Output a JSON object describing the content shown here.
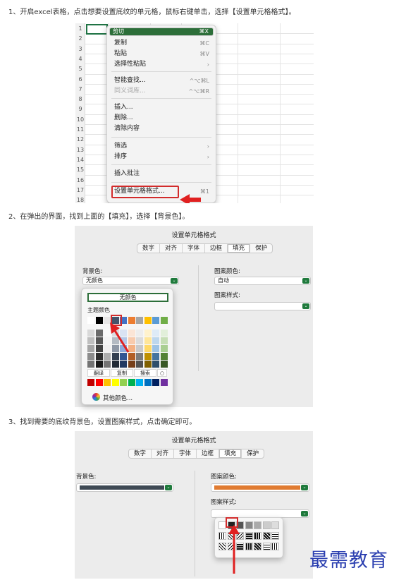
{
  "steps": {
    "s1": "1、开启excel表格，点击想要设置底纹的单元格，鼠标右键单击，选择【设置单元格格式】。",
    "s2": "2、在弹出的界面，找到上面的【填充】，选择【背景色】。",
    "s3": "3、找到需要的底纹背景色，设置图案样式，点击确定即可。"
  },
  "excel": {
    "rows": [
      "1",
      "2",
      "3",
      "4",
      "5",
      "6",
      "7",
      "8",
      "9",
      "10",
      "11",
      "12",
      "13",
      "14",
      "15",
      "16",
      "17",
      "18"
    ],
    "menu": [
      {
        "label": "剪切",
        "shortcut": "⌘X",
        "state": "selected"
      },
      {
        "label": "复制",
        "shortcut": "⌘C"
      },
      {
        "label": "粘贴",
        "shortcut": "⌘V"
      },
      {
        "label": "选择性粘贴",
        "shortcut": "›"
      },
      {
        "label": "智能查找...",
        "shortcut": "^⌥⌘L"
      },
      {
        "label": "同义词库...",
        "shortcut": "^⌥⌘R",
        "state": "disabled"
      },
      {
        "label": "插入..."
      },
      {
        "label": "删除..."
      },
      {
        "label": "清除内容"
      },
      {
        "label": "筛选",
        "shortcut": "›"
      },
      {
        "label": "排序",
        "shortcut": "›"
      },
      {
        "label": "插入批注"
      },
      {
        "label": "设置单元格格式...",
        "shortcut": "⌘1"
      }
    ]
  },
  "dialog": {
    "title": "设置单元格格式",
    "tabs": [
      "数字",
      "对齐",
      "字体",
      "边框",
      "填充",
      "保护"
    ],
    "active_tab": "填充",
    "bg_label": "背景色:",
    "bg_value": "无颜色",
    "pattern_color_label": "图案颜色:",
    "pattern_color_value": "自动",
    "pattern_style_label": "图案样式:"
  },
  "palette": {
    "no_color": "无颜色",
    "theme_label": "主题颜色",
    "buttons": [
      "翻译",
      "复制",
      "搜索"
    ],
    "more": "其他颜色...",
    "theme_colors": [
      "#ffffff",
      "#000000",
      "#e7e6e6",
      "#44546a",
      "#4472c4",
      "#ed7d31",
      "#a5a5a5",
      "#ffc000",
      "#5b9bd5",
      "#70ad47"
    ],
    "standard_colors": [
      "#c00000",
      "#ff0000",
      "#ffc000",
      "#ffff00",
      "#92d050",
      "#00b050",
      "#00b0f0",
      "#0070c0",
      "#002060",
      "#7030a0"
    ]
  },
  "panel3": {
    "bg_color": "#3f4a55",
    "pattern_color": "#e07b31"
  },
  "watermark": "最需教育"
}
